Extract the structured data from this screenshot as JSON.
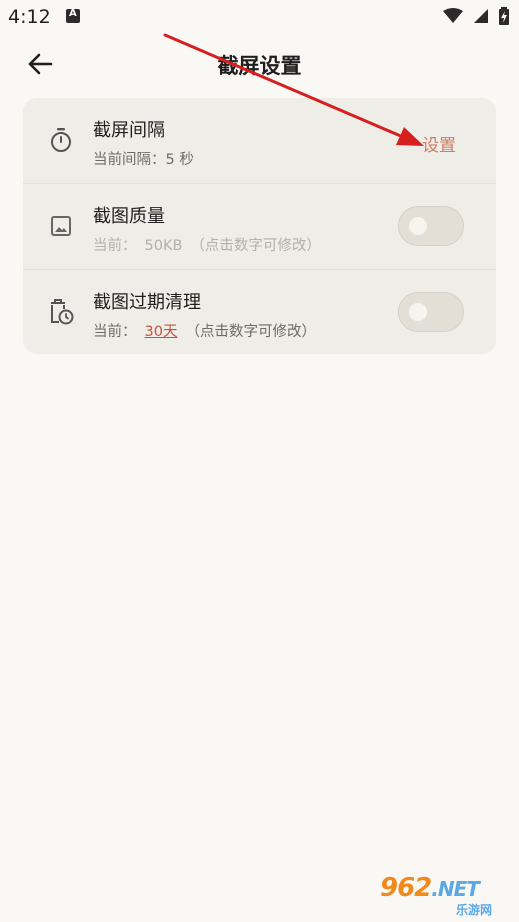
{
  "status_bar": {
    "time": "4:12",
    "icons": [
      "app-notification-icon",
      "wifi-icon",
      "signal-icon",
      "battery-charging-icon"
    ]
  },
  "app_bar": {
    "title": "截屏设置",
    "back_icon": "arrow-left-icon"
  },
  "settings": {
    "interval": {
      "icon": "timer-icon",
      "title": "截屏间隔",
      "subtitle": "当前间隔：5 秒",
      "action_label": "设置"
    },
    "quality": {
      "icon": "image-icon",
      "title": "截图质量",
      "subtitle_prefix": "当前：",
      "value": "50KB",
      "hint": "（点击数字可修改）",
      "enabled": false
    },
    "cleanup": {
      "icon": "trash-clock-icon",
      "title": "截图过期清理",
      "subtitle_prefix": "当前：",
      "value": "30天",
      "hint": "（点击数字可修改）",
      "enabled": false
    }
  },
  "colors": {
    "background": "#faf8f5",
    "card": "#efede8",
    "accent": "#d07a62",
    "link_value": "#c9523e",
    "annotation_arrow": "#d62020"
  },
  "watermark": {
    "brand": "962",
    "net": ".NET",
    "sub": "乐游网"
  }
}
